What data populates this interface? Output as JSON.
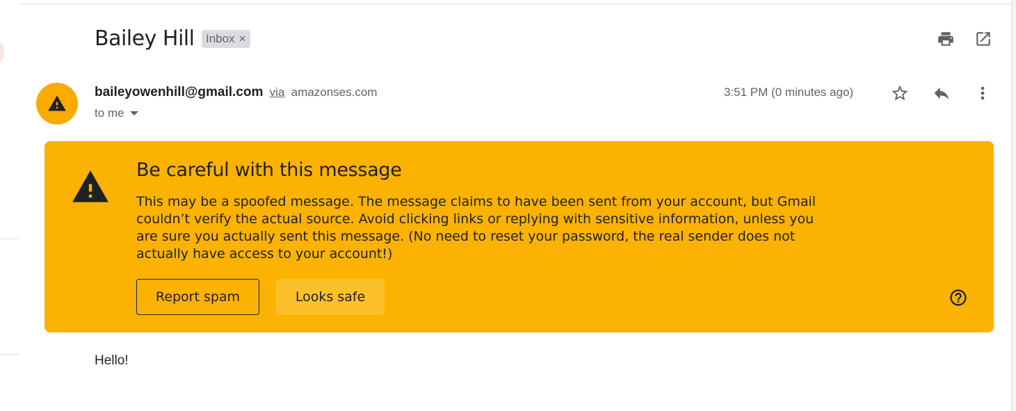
{
  "subject": "Bailey Hill",
  "label": {
    "name": "Inbox",
    "remove": "×"
  },
  "toolbar": {
    "print_icon": "print-icon",
    "popout_icon": "open-in-new-window-icon"
  },
  "sender": {
    "email": "baileyowenhill@gmail.com",
    "via": "via",
    "domain": "amazonses.com",
    "to": "to me",
    "avatar_icon": "warning-icon"
  },
  "time": "3:51 PM (0 minutes ago)",
  "header_actions": {
    "star_icon": "star-icon",
    "reply_icon": "reply-icon",
    "more_icon": "more-vert-icon"
  },
  "warning": {
    "title": "Be careful with this message",
    "body": "This may be a spoofed message. The message claims to have been sent from your account, but Gmail couldn’t verify the actual source. Avoid clicking links or replying with sensitive information, unless you are sure you actually sent this message. (No need to reset your password, the real sender does not actually have access to your account!)",
    "report_spam": "Report spam",
    "looks_safe": "Looks safe",
    "help_icon": "help-icon"
  },
  "message_body": "Hello!",
  "colors": {
    "warning_bg": "#fbb202",
    "avatar_bg": "#f9ab00",
    "safe_button": "#fcc02a"
  }
}
